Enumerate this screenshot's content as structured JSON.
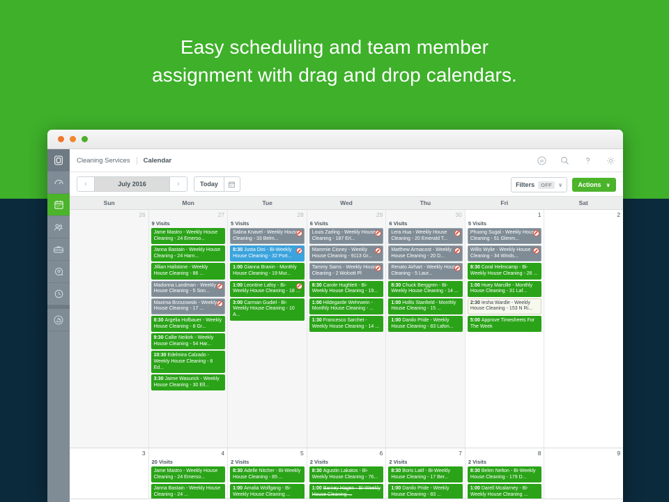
{
  "headline": {
    "line1": "Easy scheduling and team member",
    "line2": "assignment with drag and drop calendars."
  },
  "colors": {
    "hero_background": "#3eb02a",
    "page_background": "#0b2a3c",
    "accent_green": "#4bb42a",
    "event_green": "#2aa318",
    "event_grey": "#7f8c96",
    "event_blue": "#3ba3dd",
    "event_cream": "#f7f8ee",
    "sidebar": "#7f8c96"
  },
  "window": {
    "traffic_lights": [
      "close",
      "minimize",
      "zoom"
    ]
  },
  "sidebar": {
    "items": [
      {
        "icon": "app-logo-icon",
        "label": "Logo",
        "active": false
      },
      {
        "icon": "gauge-icon",
        "label": "Dashboard",
        "active": false
      },
      {
        "icon": "calendar-icon",
        "label": "Calendar",
        "active": true
      },
      {
        "icon": "people-icon",
        "label": "Customers",
        "active": false
      },
      {
        "icon": "toolbox-icon",
        "label": "Jobs",
        "active": false
      },
      {
        "icon": "chat-icon",
        "label": "Messages",
        "active": false
      },
      {
        "icon": "clock-icon",
        "label": "Time Tracking",
        "active": false
      },
      {
        "icon": "thumbs-up-icon",
        "label": "Reviews",
        "active": false
      }
    ]
  },
  "topbar": {
    "breadcrumb_app": "Cleaning Services",
    "breadcrumb_page": "Calendar",
    "icons": [
      {
        "name": "quickbooks-icon",
        "glyph": "qb"
      },
      {
        "name": "search-icon",
        "glyph": "search"
      },
      {
        "name": "help-icon",
        "glyph": "?"
      },
      {
        "name": "settings-gear-icon",
        "glyph": "gear"
      }
    ]
  },
  "toolbar": {
    "prev_label": "‹",
    "period_label": "July 2016",
    "next_label": "›",
    "today_label": "Today",
    "calendar_picker_icon": "calendar-icon",
    "filters_label": "Filters",
    "filters_state": "OFF",
    "filters_caret": "∨",
    "actions_label": "Actions",
    "actions_caret": "∨"
  },
  "calendar": {
    "day_headers": [
      "Sun",
      "Mon",
      "Tue",
      "Wed",
      "Thu",
      "Fri",
      "Sat"
    ],
    "weeks": [
      {
        "days": [
          {
            "num": "26",
            "current_month": false,
            "visits": "",
            "events": []
          },
          {
            "num": "27",
            "current_month": false,
            "visits": "9 Visits",
            "events": [
              {
                "time": "",
                "text": "Jame Mastro - Weekly House Cleaning - 24 Emerso...",
                "style": "green",
                "flag": false,
                "cancelled": false
              },
              {
                "time": "",
                "text": "Janna Bastain - Weekly House Cleaning - 24 Harn...",
                "style": "green",
                "flag": false,
                "cancelled": false
              },
              {
                "time": "",
                "text": "Jillian Hailstone - Weekly House Cleaning - 86 ...",
                "style": "green",
                "flag": false,
                "cancelled": false
              },
              {
                "time": "",
                "text": "Madonna Landman - Weekly House Cleaning - 5 Son...",
                "style": "grey",
                "flag": true,
                "cancelled": false
              },
              {
                "time": "",
                "text": "Maxima Brzozowski - Weekly House Cleaning - 17 ...",
                "style": "grey",
                "flag": true,
                "cancelled": false
              },
              {
                "time": "8:30",
                "text": "Argelia Hofbauer - Weekly House Cleaning - 8 Gr...",
                "style": "green",
                "flag": false,
                "cancelled": false
              },
              {
                "time": "9:30",
                "text": "Callie Neikirk - Weekly House Cleaning - 54 Har...",
                "style": "green",
                "flag": false,
                "cancelled": false
              },
              {
                "time": "10:30",
                "text": "Edelmira Calzado - Weekly House Cleaning - 8 Ed...",
                "style": "green",
                "flag": false,
                "cancelled": false
              },
              {
                "time": "3:30",
                "text": "Jaime Wasurick - Weekly House Cleaning - 30 Ell...",
                "style": "green",
                "flag": false,
                "cancelled": false
              }
            ]
          },
          {
            "num": "28",
            "current_month": false,
            "visits": "5 Visits",
            "events": [
              {
                "time": "",
                "text": "Salina Knavel - Weekly House Cleaning - 33 Belm...",
                "style": "grey",
                "flag": true,
                "cancelled": false
              },
              {
                "time": "8:30",
                "text": "Justa Dini - Bi-Weekly House Cleaning - 32 Port...",
                "style": "blue",
                "flag": true,
                "cancelled": false
              },
              {
                "time": "1:00",
                "text": "Gianna Branin - Monthly House Cleaning - 19 Mur...",
                "style": "green",
                "flag": false,
                "cancelled": false
              },
              {
                "time": "1:00",
                "text": "Leontine Lafoy - Bi-Weekly House Cleaning - 18 ...",
                "style": "green",
                "flag": true,
                "cancelled": false
              },
              {
                "time": "3:00",
                "text": "Carman Gudiel - Bi-Weekly House Cleaning - 10 A...",
                "style": "green",
                "flag": false,
                "cancelled": false
              }
            ]
          },
          {
            "num": "29",
            "current_month": false,
            "visits": "6 Visits",
            "events": [
              {
                "time": "",
                "text": "Louis Zarling - Weekly House Cleaning - 187 Erl...",
                "style": "grey",
                "flag": true,
                "cancelled": false
              },
              {
                "time": "",
                "text": "Mammie Cisney - Weekly House Cleaning - 9113 Gr...",
                "style": "grey",
                "flag": true,
                "cancelled": false
              },
              {
                "time": "",
                "text": "Tammy Sams - Weekly House Cleaning - 2 Wolcott Pl",
                "style": "grey",
                "flag": true,
                "cancelled": false
              },
              {
                "time": "8:30",
                "text": "Carole Hughlett - Bi-Weekly House Cleaning - 19...",
                "style": "green",
                "flag": false,
                "cancelled": false
              },
              {
                "time": "1:00",
                "text": "Hildegarde Wehrwein - Monthly House Cleaning - ...",
                "style": "green",
                "flag": false,
                "cancelled": false
              },
              {
                "time": "1:30",
                "text": "Francesco Sarchet - Weekly House Cleaning - 14 ...",
                "style": "green",
                "flag": false,
                "cancelled": false
              }
            ]
          },
          {
            "num": "30",
            "current_month": false,
            "visits": "6 Visits",
            "events": [
              {
                "time": "",
                "text": "Lera Hua - Weekly House Cleaning - 20 Emerald T...",
                "style": "grey",
                "flag": true,
                "cancelled": false
              },
              {
                "time": "",
                "text": "Matthew Armacost - Weekly House Cleaning - 20 D...",
                "style": "grey",
                "flag": true,
                "cancelled": false
              },
              {
                "time": "",
                "text": "Renato Airhart - Weekly House Cleaning - 5 Laur...",
                "style": "grey",
                "flag": true,
                "cancelled": false
              },
              {
                "time": "8:30",
                "text": "Chuck Berggren - Bi-Weekly House Cleaning - 14 ...",
                "style": "green",
                "flag": false,
                "cancelled": false
              },
              {
                "time": "1:00",
                "text": "Hollis Stanfield - Monthly House Cleaning - 15 ...",
                "style": "green",
                "flag": false,
                "cancelled": false
              },
              {
                "time": "1:00",
                "text": "Danilo Pride - Weekly House Cleaning - 83 Lafon...",
                "style": "green",
                "flag": false,
                "cancelled": false
              }
            ]
          },
          {
            "num": "1",
            "current_month": true,
            "visits": "5 Visits",
            "events": [
              {
                "time": "",
                "text": "Phuong Sugal - Weekly House Cleaning - 51 Glenm...",
                "style": "grey",
                "flag": true,
                "cancelled": false
              },
              {
                "time": "",
                "text": "Willis Wylie - Weekly House Cleaning - 34 Winds...",
                "style": "grey",
                "flag": true,
                "cancelled": false
              },
              {
                "time": "8:30",
                "text": "Coral Helmcamp - Bi-Weekly House Cleaning - 26 ...",
                "style": "green",
                "flag": false,
                "cancelled": false
              },
              {
                "time": "1:00",
                "text": "Huey Marcille - Monthly House Cleaning - 31 Laf...",
                "style": "green",
                "flag": false,
                "cancelled": false
              },
              {
                "time": "2:30",
                "text": "Iesha Wardle - Weekly House Cleaning - 153 N Ri...",
                "style": "cream",
                "flag": false,
                "cancelled": false
              },
              {
                "time": "5:00",
                "text": "Approve Timesheets For The Week",
                "style": "green",
                "flag": false,
                "cancelled": false
              }
            ]
          },
          {
            "num": "2",
            "current_month": true,
            "visits": "",
            "events": []
          }
        ]
      },
      {
        "days": [
          {
            "num": "3",
            "current_month": true,
            "visits": "",
            "events": []
          },
          {
            "num": "4",
            "current_month": true,
            "visits": "20 Visits",
            "events": [
              {
                "time": "",
                "text": "Jame Mastro - Weekly House Cleaning - 24 Emerso...",
                "style": "green",
                "flag": false,
                "cancelled": false
              },
              {
                "time": "",
                "text": "Janna Bastain - Weekly House Cleaning - 24 ...",
                "style": "green",
                "flag": false,
                "cancelled": false
              }
            ]
          },
          {
            "num": "5",
            "current_month": true,
            "visits": "2 Visits",
            "events": [
              {
                "time": "8:30",
                "text": "Adelle Nitcher - Bi-Weekly House Cleaning - 85 ...",
                "style": "green",
                "flag": false,
                "cancelled": false
              },
              {
                "time": "1:00",
                "text": "Amalia Wolfgang - Bi-Weekly House Cleaning ...",
                "style": "green",
                "flag": false,
                "cancelled": false
              }
            ]
          },
          {
            "num": "6",
            "current_month": true,
            "visits": "2 Visits",
            "events": [
              {
                "time": "8:30",
                "text": "Agustin Lakatos - Bi-Weekly House Cleaning - 76...",
                "style": "green",
                "flag": false,
                "cancelled": false
              },
              {
                "time": "1:00",
                "text": "Barney Hagen - Bi-Weekly House Cleaning ...",
                "style": "green",
                "flag": false,
                "cancelled": true
              }
            ]
          },
          {
            "num": "7",
            "current_month": true,
            "visits": "2 Visits",
            "events": [
              {
                "time": "8:30",
                "text": "Boris Latif - Bi-Weekly House Cleaning - 17 Ber...",
                "style": "green",
                "flag": false,
                "cancelled": false
              },
              {
                "time": "1:00",
                "text": "Danilo Pride - Weekly House Cleaning - 83 ...",
                "style": "green",
                "flag": false,
                "cancelled": false
              }
            ]
          },
          {
            "num": "8",
            "current_month": true,
            "visits": "2 Visits",
            "events": [
              {
                "time": "8:30",
                "text": "Belen Nelton - Bi-Weekly House Cleaning - 179 D...",
                "style": "green",
                "flag": false,
                "cancelled": false
              },
              {
                "time": "1:00",
                "text": "Darell Mcalarney - Bi-Weekly House Cleaning ...",
                "style": "green",
                "flag": false,
                "cancelled": false
              }
            ]
          },
          {
            "num": "9",
            "current_month": true,
            "visits": "",
            "events": []
          }
        ]
      }
    ]
  }
}
